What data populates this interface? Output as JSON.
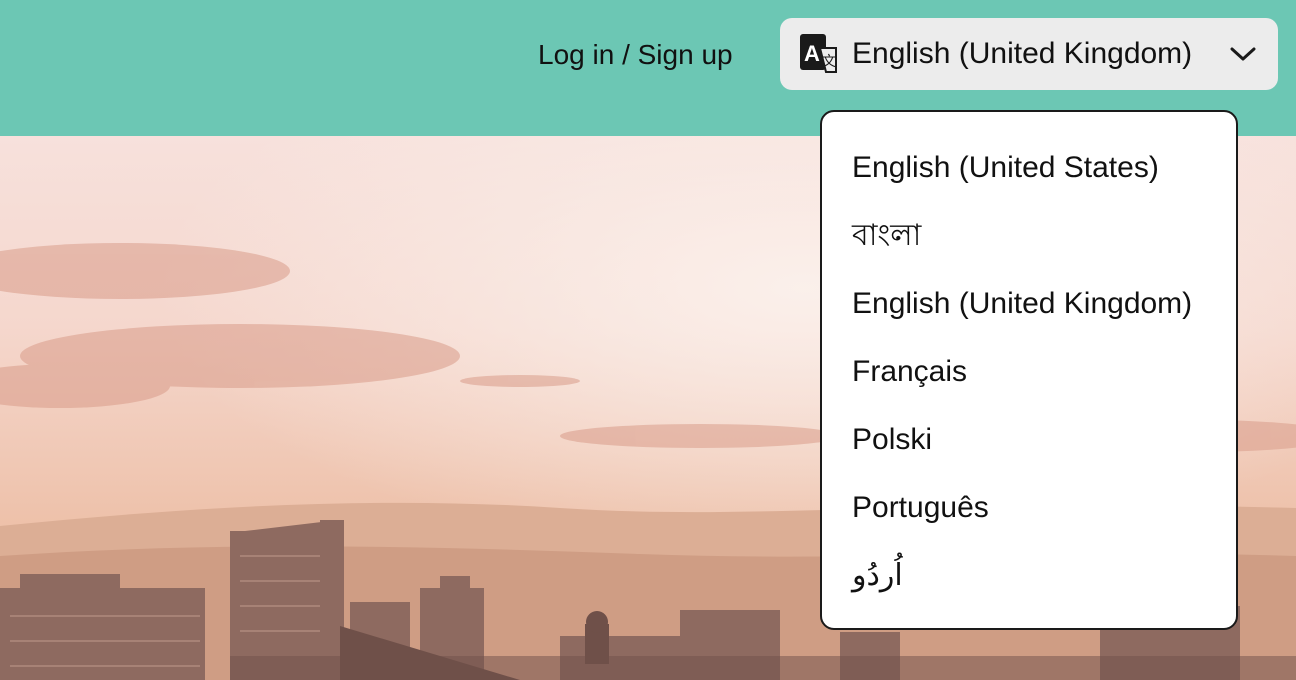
{
  "header": {
    "login_label": "Log in / Sign up",
    "language_button": {
      "icon": "translate-icon",
      "current": "English (United Kingdom)",
      "chevron_icon": "chevron-down-icon"
    }
  },
  "language_menu": {
    "options": [
      "English (United States)",
      "বাংলা",
      "English (United Kingdom)",
      "Français",
      "Polski",
      "Português",
      "اُردُو"
    ]
  },
  "colors": {
    "header_bg": "#6cc7b4",
    "button_bg": "#ececec",
    "menu_border": "#1a1a1a"
  }
}
